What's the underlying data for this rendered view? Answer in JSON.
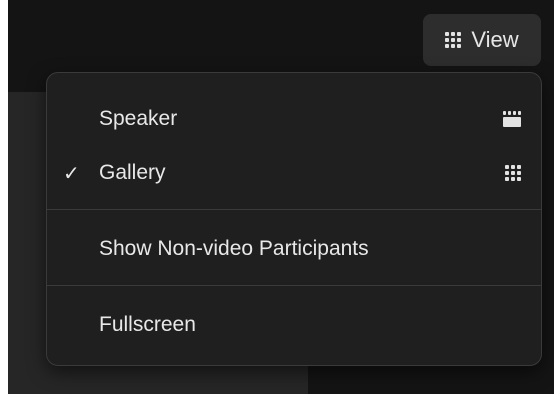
{
  "toolbar": {
    "view_button": {
      "label": "View",
      "icon": "grid-icon"
    }
  },
  "view_menu": {
    "items": [
      {
        "label": "Speaker",
        "checked": false,
        "icon": "speaker-view-icon"
      },
      {
        "label": "Gallery",
        "checked": true,
        "check_mark": "✓",
        "icon": "gallery-grid-icon"
      },
      {
        "label": "Show Non-video Participants"
      },
      {
        "label": "Fullscreen"
      }
    ]
  },
  "colors": {
    "background": "#141414",
    "menu_background": "#1f1f1f",
    "button_background": "#2d2d2d",
    "text": "#e8e8e8",
    "divider": "#3a3a3a"
  }
}
